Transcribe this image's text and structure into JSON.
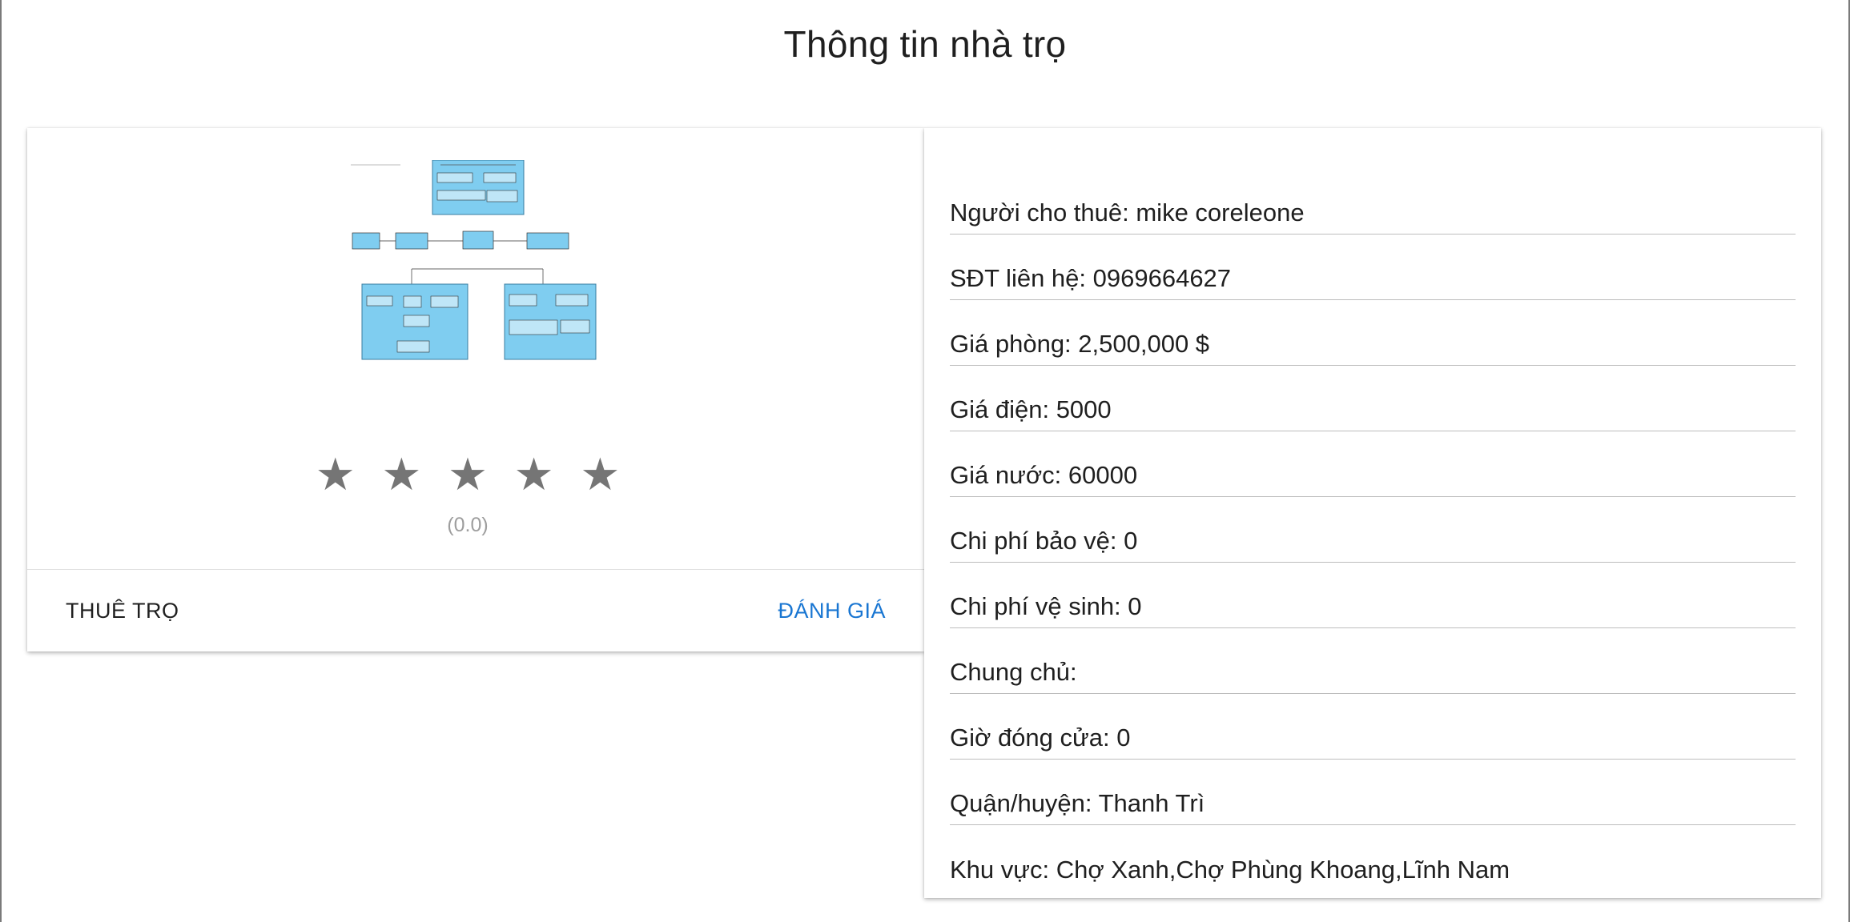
{
  "page": {
    "title": "Thông tin nhà trọ"
  },
  "listing": {
    "rating": {
      "stars": 5,
      "filled": 0,
      "count_text": "(0.0)"
    },
    "actions": {
      "rent_label": "THUÊ TRỌ",
      "review_label": "ĐÁNH GIÁ"
    }
  },
  "details": {
    "landlord": "Người cho thuê: mike coreleone",
    "phone": "SĐT liên hệ: 0969664627",
    "room_price": "Giá phòng: 2,500,000 $",
    "electricity_price": "Giá điện: 5000",
    "water_price": "Giá nước: 60000",
    "security_fee": "Chi phí bảo vệ: 0",
    "cleaning_fee": "Chi phí vệ sinh: 0",
    "shared_owner": "Chung chủ:",
    "closing_time": "Giờ đóng cửa: 0",
    "district": "Quận/huyện: Thanh Trì",
    "area": "Khu vực: Chợ Xanh,Chợ Phùng Khoang,Lĩnh Nam"
  },
  "colors": {
    "accent": "#1976d2",
    "star": "#757575",
    "diagram_box": "#7fcdf0"
  }
}
